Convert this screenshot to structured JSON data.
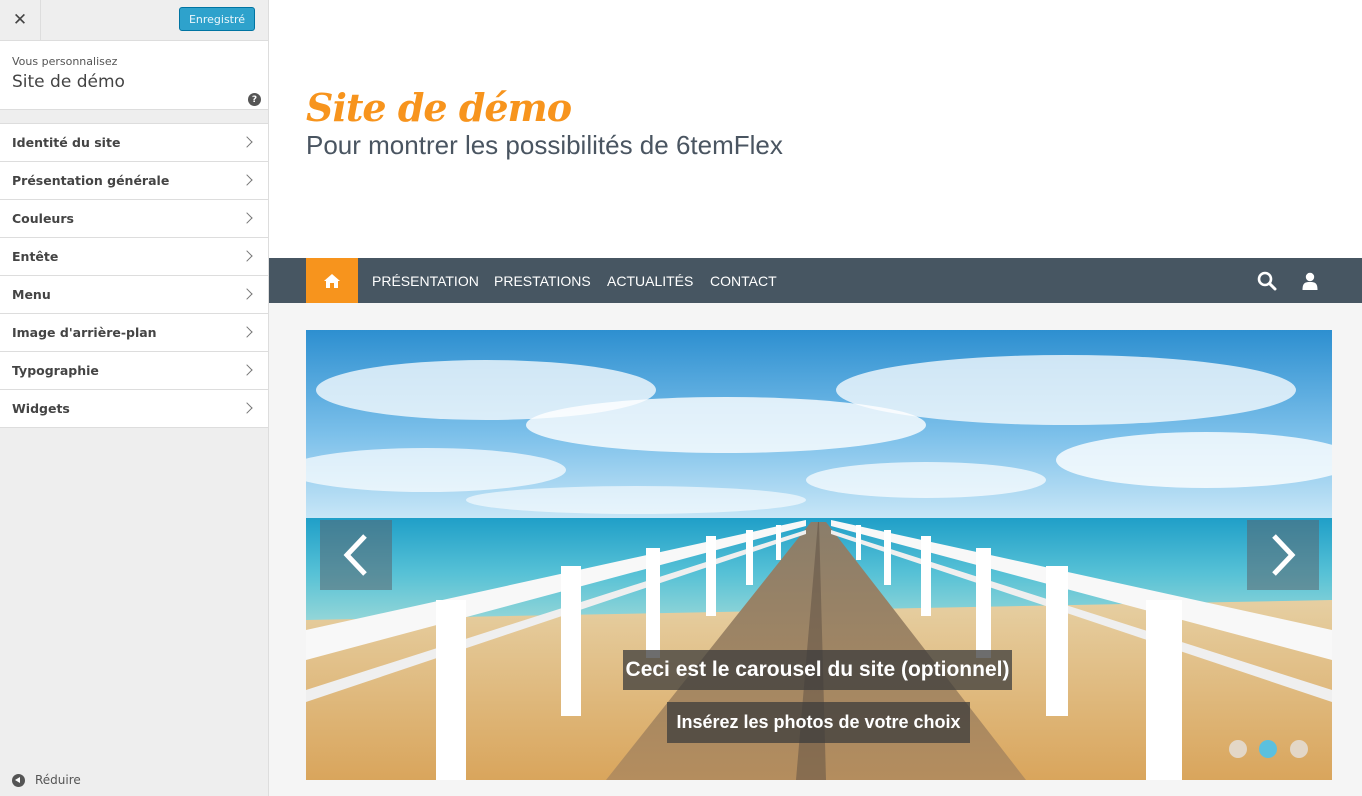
{
  "customizer": {
    "close_icon": "close-icon",
    "save_label": "Enregistré",
    "info_label": "Vous personnalisez",
    "info_title": "Site de démo",
    "help_icon": "help-icon",
    "sections": [
      {
        "label": "Identité du site"
      },
      {
        "label": "Présentation générale"
      },
      {
        "label": "Couleurs"
      },
      {
        "label": "Entête"
      },
      {
        "label": "Menu"
      },
      {
        "label": "Image d'arrière-plan"
      },
      {
        "label": "Typographie"
      },
      {
        "label": "Widgets"
      }
    ],
    "collapse_label": "Réduire"
  },
  "preview": {
    "site_title": "Site de démo",
    "tagline": "Pour montrer les possibilités de 6temFlex",
    "nav": {
      "home_icon": "home-icon",
      "links": [
        "PRÉSENTATION",
        "PRESTATIONS",
        "ACTUALITÉS",
        "CONTACT"
      ],
      "search_icon": "search-icon",
      "user_icon": "user-icon"
    },
    "carousel": {
      "caption_title": "Ceci est le carousel du site (optionnel)",
      "caption_text": "Insérez les photos de votre choix",
      "slide_count": 3,
      "active_slide": 2
    }
  },
  "colors": {
    "accent": "#f7941d",
    "nav_bg": "#475662",
    "save_button": "#2ea2cc",
    "active_dot": "#5bc0de"
  }
}
